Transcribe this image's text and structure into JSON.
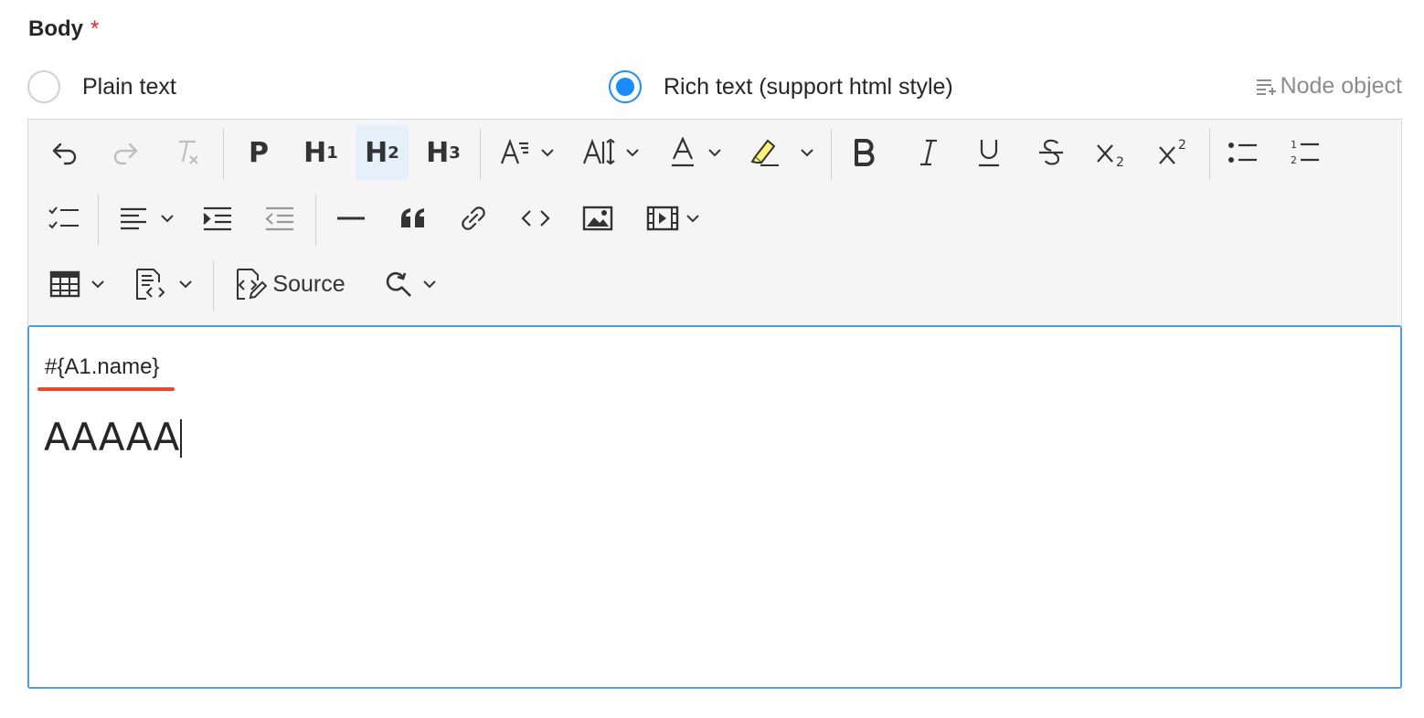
{
  "field": {
    "label": "Body",
    "required_mark": "*"
  },
  "radios": {
    "plain": {
      "label": "Plain text",
      "checked": false
    },
    "rich": {
      "label": "Rich text (support html style)",
      "checked": true
    }
  },
  "node_object": {
    "label": "Node object",
    "icon": "insert-list-icon"
  },
  "toolbar": {
    "headings": {
      "p": "P",
      "h1": "H",
      "h1_sub": "1",
      "h2": "H",
      "h2_sub": "2",
      "h3": "H",
      "h3_sub": "3"
    },
    "active_button": "heading-2",
    "source_label": "Source",
    "accent": "#1a8cff"
  },
  "editor": {
    "variable_text": "#{A1.name}",
    "body_text": "AAAAA",
    "spellcheck_underline_color": "#e8472b",
    "focus_border_color": "#4a9fe8"
  }
}
